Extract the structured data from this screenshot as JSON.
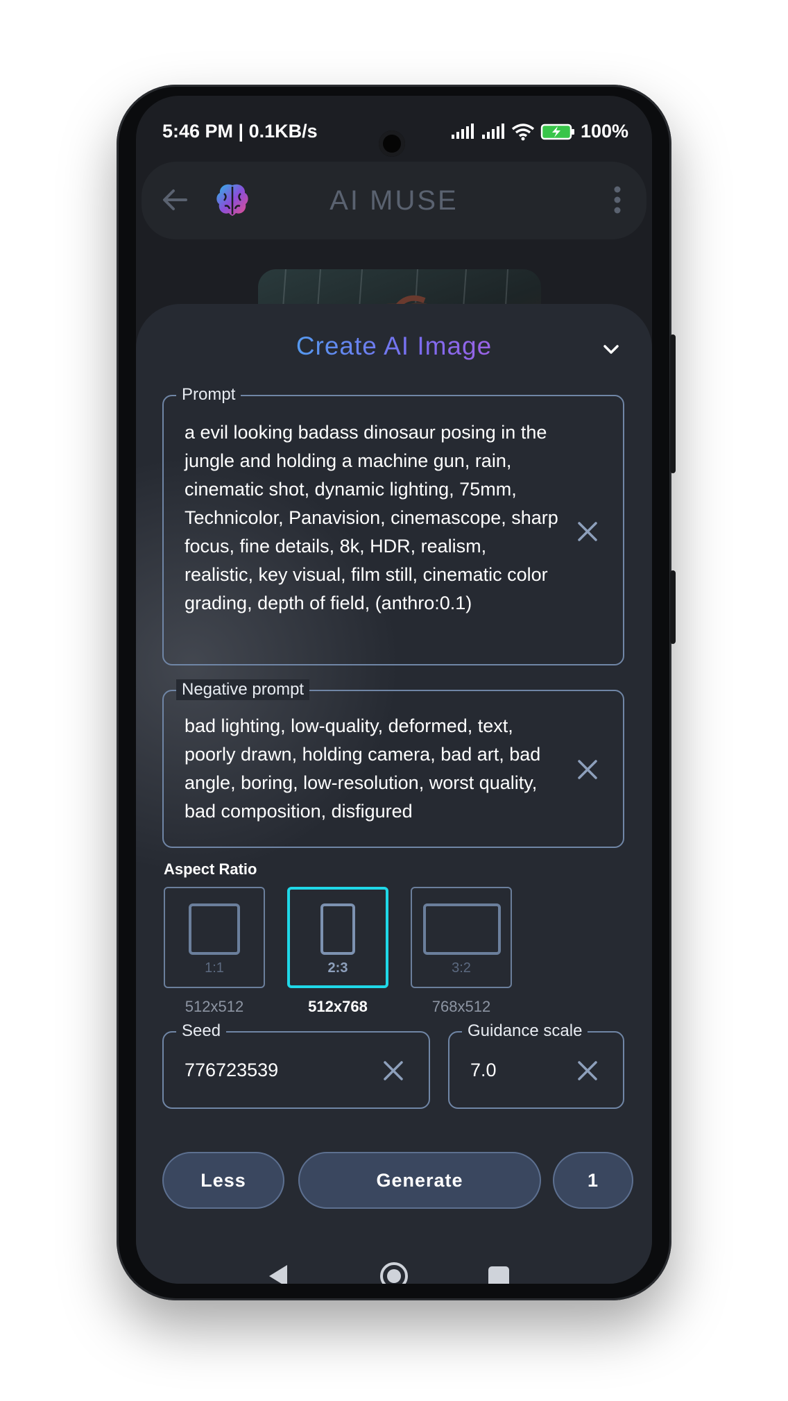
{
  "status_bar": {
    "time_speed": "5:46 PM | 0.1KB/s",
    "battery": "100%"
  },
  "app_bar": {
    "title": "AI MUSE",
    "icons": [
      "back-arrow-icon",
      "brain-logo-icon",
      "more-vert-icon"
    ]
  },
  "sheet": {
    "title": "Create AI Image",
    "prompt": {
      "label": "Prompt",
      "value": "a evil looking badass dinosaur posing in the jungle and holding a machine gun, rain, cinematic shot, dynamic lighting, 75mm, Technicolor, Panavision, cinemascope, sharp focus, fine details, 8k, HDR, realism, realistic, key visual, film still, cinematic color grading, depth of field, (anthro:0.1)"
    },
    "negative_prompt": {
      "label": "Negative prompt",
      "value": "bad lighting, low-quality, deformed, text, poorly drawn, holding camera, bad art, bad angle, boring, low-resolution, worst quality, bad composition, disfigured"
    },
    "aspect_ratio": {
      "label": "Aspect Ratio",
      "options": [
        {
          "name": "1:1",
          "size": "512x512",
          "selected": false
        },
        {
          "name": "2:3",
          "size": "512x768",
          "selected": true
        },
        {
          "name": "3:2",
          "size": "768x512",
          "selected": false
        }
      ]
    },
    "seed": {
      "label": "Seed",
      "value": "776723539"
    },
    "guidance_scale": {
      "label": "Guidance scale",
      "value": "7.0"
    },
    "buttons": {
      "less": "Less",
      "generate": "Generate",
      "count": "1"
    }
  },
  "colors": {
    "accent": "#1fd8e8",
    "sheet_background": "#262a32",
    "button": "#3a475f",
    "field_border": "#7086a6"
  }
}
